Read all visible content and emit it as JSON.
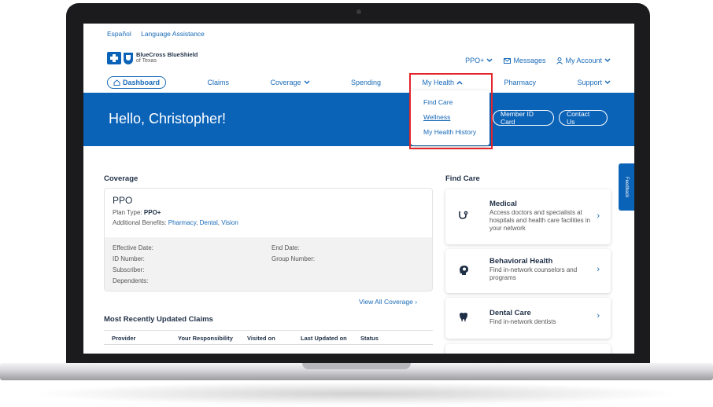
{
  "utility_links": [
    "Español",
    "Language Assistance"
  ],
  "logo": {
    "name": "BlueCross BlueShield",
    "sub": "of Texas"
  },
  "top_right": {
    "plan": "PPO+",
    "messages": "Messages",
    "account": "My Account"
  },
  "nav": {
    "dashboard": "Dashboard",
    "claims": "Claims",
    "coverage": "Coverage",
    "spending": "Spending",
    "my_health": "My Health",
    "pharmacy": "Pharmacy",
    "support": "Support"
  },
  "my_health_menu": [
    "Find Care",
    "Wellness",
    "My Health History"
  ],
  "hero": {
    "greeting": "Hello, Christopher!",
    "member_id_btn": "Member ID Card",
    "contact_btn": "Contact Us"
  },
  "coverage": {
    "title": "Coverage",
    "plan": "PPO",
    "plan_type_label": "Plan Type:",
    "plan_type": "PPO+",
    "benefits_label": "Additional Benefits:",
    "benefits": [
      "Pharmacy",
      "Dental",
      "Vision"
    ],
    "effective_date": "Effective Date:",
    "end_date": "End Date:",
    "id_number": "ID Number:",
    "group_number": "Group Number:",
    "subscriber": "Subscriber:",
    "dependents": "Dependents:",
    "view_all": "View All Coverage"
  },
  "claims": {
    "title": "Most Recently Updated Claims",
    "columns": [
      "Provider",
      "Your Responsibility",
      "Visited on",
      "Last Updated on",
      "Status"
    ]
  },
  "find_care": {
    "title": "Find Care",
    "cards": [
      {
        "icon": "stethoscope-icon",
        "title": "Medical",
        "desc": "Access doctors and specialists at hospitals and health care facilities in your network"
      },
      {
        "icon": "head-brain-icon",
        "title": "Behavioral Health",
        "desc": "Find in-network counselors and programs"
      },
      {
        "icon": "tooth-icon",
        "title": "Dental Care",
        "desc": "Find in-network dentists"
      }
    ]
  },
  "feedback": "Feedback",
  "colors": {
    "brand": "#0b63b8",
    "link": "#1a6bb8",
    "highlight": "#e3262b"
  }
}
